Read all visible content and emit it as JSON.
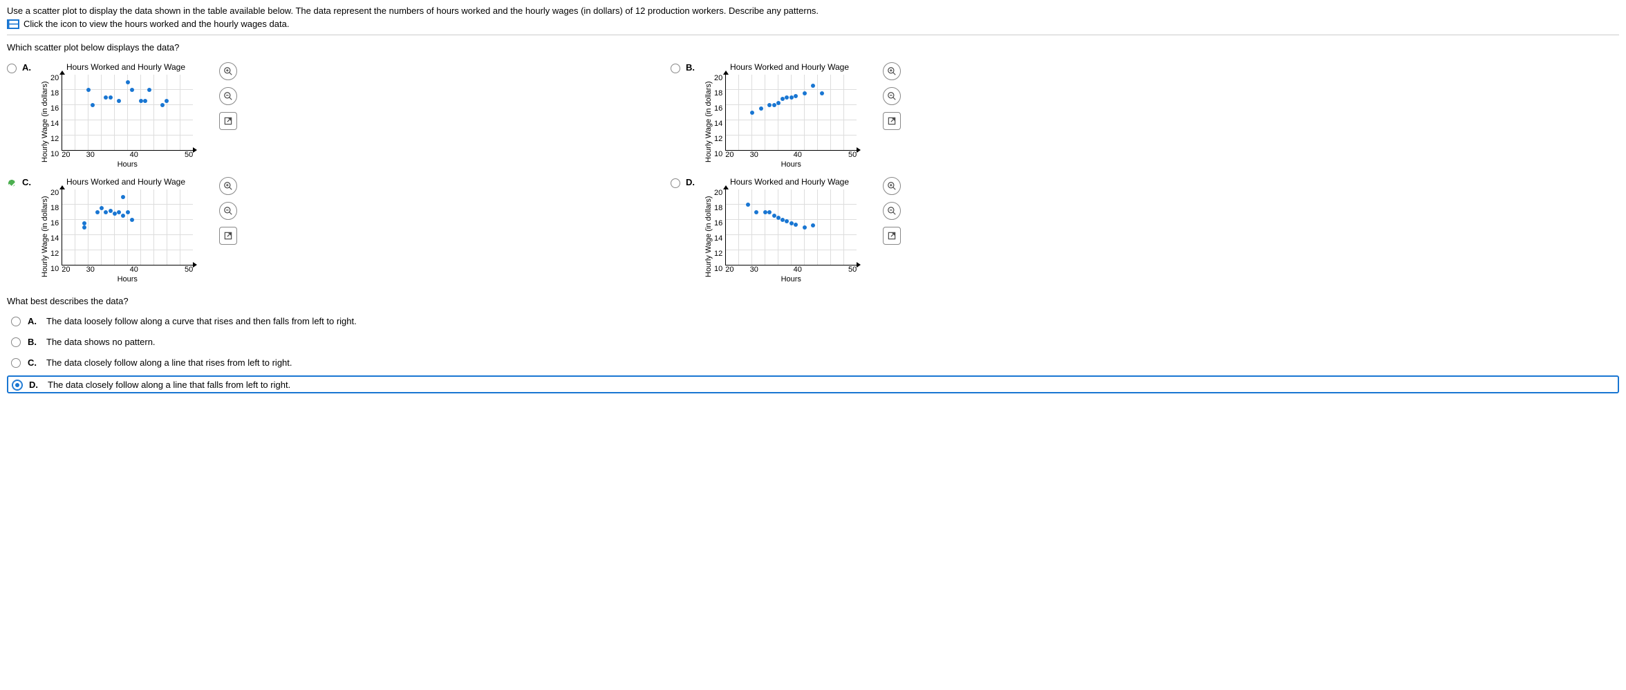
{
  "intro": {
    "main_text": "Use a scatter plot to display the data shown in the table available below. The data represent the numbers of hours worked and the hourly wages (in dollars) of 12 production workers. Describe any patterns.",
    "link_text": "Click the icon to view the hours worked and the hourly wages data."
  },
  "question1": {
    "text": "Which scatter plot below displays the data?",
    "options": {
      "A": {
        "label": "A."
      },
      "B": {
        "label": "B."
      },
      "C": {
        "label": "C."
      },
      "D": {
        "label": "D."
      }
    },
    "selected": "C"
  },
  "plots": {
    "common": {
      "title": "Hours Worked and Hourly Wage",
      "xlabel": "Hours",
      "ylabel": "Hourly Wage (in dollars)",
      "y_ticks": [
        "20",
        "18",
        "16",
        "14",
        "12",
        "10"
      ],
      "x_ticks": [
        "20",
        "30",
        "40",
        "50"
      ]
    }
  },
  "chart_data": [
    {
      "id": "A",
      "type": "scatter",
      "title": "Hours Worked and Hourly Wage",
      "xlabel": "Hours",
      "ylabel": "Hourly Wage (in dollars)",
      "xlim": [
        20,
        50
      ],
      "ylim": [
        10,
        20
      ],
      "points": [
        {
          "x": 26,
          "y": 18
        },
        {
          "x": 27,
          "y": 16
        },
        {
          "x": 30,
          "y": 17
        },
        {
          "x": 31,
          "y": 17
        },
        {
          "x": 33,
          "y": 16.5
        },
        {
          "x": 35,
          "y": 19
        },
        {
          "x": 36,
          "y": 18
        },
        {
          "x": 38,
          "y": 16.5
        },
        {
          "x": 39,
          "y": 16.5
        },
        {
          "x": 40,
          "y": 18
        },
        {
          "x": 43,
          "y": 16
        },
        {
          "x": 44,
          "y": 16.5
        }
      ]
    },
    {
      "id": "B",
      "type": "scatter",
      "title": "Hours Worked and Hourly Wage",
      "xlabel": "Hours",
      "ylabel": "Hourly Wage (in dollars)",
      "xlim": [
        20,
        50
      ],
      "ylim": [
        10,
        20
      ],
      "points": [
        {
          "x": 26,
          "y": 15
        },
        {
          "x": 28,
          "y": 15.5
        },
        {
          "x": 30,
          "y": 16
        },
        {
          "x": 31,
          "y": 16
        },
        {
          "x": 32,
          "y": 16.2
        },
        {
          "x": 33,
          "y": 16.8
        },
        {
          "x": 34,
          "y": 17
        },
        {
          "x": 35,
          "y": 17
        },
        {
          "x": 36,
          "y": 17.2
        },
        {
          "x": 38,
          "y": 17.5
        },
        {
          "x": 40,
          "y": 18.5
        },
        {
          "x": 42,
          "y": 17.5
        }
      ]
    },
    {
      "id": "C",
      "type": "scatter",
      "title": "Hours Worked and Hourly Wage",
      "xlabel": "Hours",
      "ylabel": "Hourly Wage (in dollars)",
      "xlim": [
        20,
        50
      ],
      "ylim": [
        10,
        20
      ],
      "points": [
        {
          "x": 25,
          "y": 15.5
        },
        {
          "x": 25,
          "y": 15
        },
        {
          "x": 28,
          "y": 17
        },
        {
          "x": 29,
          "y": 17.5
        },
        {
          "x": 30,
          "y": 17
        },
        {
          "x": 31,
          "y": 17.2
        },
        {
          "x": 32,
          "y": 16.8
        },
        {
          "x": 33,
          "y": 17
        },
        {
          "x": 34,
          "y": 19
        },
        {
          "x": 35,
          "y": 17
        },
        {
          "x": 36,
          "y": 16
        },
        {
          "x": 34,
          "y": 16.5
        }
      ]
    },
    {
      "id": "D",
      "type": "scatter",
      "title": "Hours Worked and Hourly Wage",
      "xlabel": "Hours",
      "ylabel": "Hourly Wage (in dollars)",
      "xlim": [
        20,
        50
      ],
      "ylim": [
        10,
        20
      ],
      "points": [
        {
          "x": 25,
          "y": 18
        },
        {
          "x": 27,
          "y": 17
        },
        {
          "x": 29,
          "y": 17
        },
        {
          "x": 30,
          "y": 17
        },
        {
          "x": 31,
          "y": 16.5
        },
        {
          "x": 32,
          "y": 16.2
        },
        {
          "x": 33,
          "y": 16
        },
        {
          "x": 34,
          "y": 15.8
        },
        {
          "x": 35,
          "y": 15.5
        },
        {
          "x": 36,
          "y": 15.3
        },
        {
          "x": 38,
          "y": 15
        },
        {
          "x": 40,
          "y": 15.2
        }
      ]
    }
  ],
  "question2": {
    "text": "What best describes the data?",
    "options": {
      "A": {
        "label": "A.",
        "text": "The data loosely follow along a curve that rises and then falls from left to right."
      },
      "B": {
        "label": "B.",
        "text": "The data shows no pattern."
      },
      "C": {
        "label": "C.",
        "text": "The data closely follow along a line that rises from left to right."
      },
      "D": {
        "label": "D.",
        "text": "The data closely follow along a line that falls from left to right."
      }
    },
    "selected": "D"
  }
}
